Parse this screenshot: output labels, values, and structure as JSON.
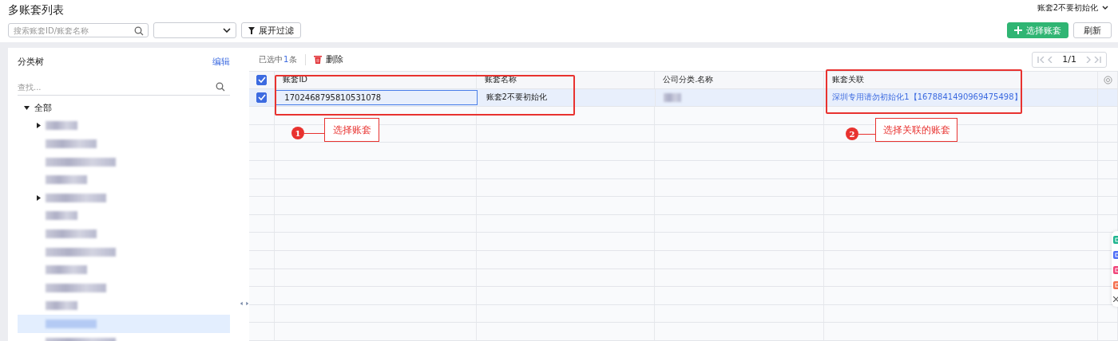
{
  "header": {
    "title": "多账套列表",
    "account_switcher": "账套2不要初始化",
    "search": {
      "placeholder": "搜索账套ID/账套名称"
    },
    "filter_button": "展开过滤",
    "buttons": [
      {
        "kind": "primary",
        "label": "选择账套"
      },
      {
        "kind": "default",
        "label": "刷新"
      }
    ]
  },
  "tree": {
    "title": "分类树",
    "edit_link": "编辑",
    "search": {
      "placeholder": "查找..."
    },
    "root": {
      "label": "全部",
      "expanded": true,
      "children": [
        {
          "kind": "redacted",
          "has_children": true,
          "selected": false
        },
        {
          "kind": "redacted",
          "has_children": false,
          "selected": false
        },
        {
          "kind": "redacted",
          "has_children": false,
          "selected": false
        },
        {
          "kind": "redacted",
          "has_children": false,
          "selected": false
        },
        {
          "kind": "redacted",
          "has_children": true,
          "selected": false
        },
        {
          "kind": "redacted",
          "has_children": false,
          "selected": false
        },
        {
          "kind": "redacted",
          "has_children": false,
          "selected": false
        },
        {
          "kind": "redacted",
          "has_children": false,
          "selected": false
        },
        {
          "kind": "redacted",
          "has_children": false,
          "selected": false
        },
        {
          "kind": "redacted",
          "has_children": false,
          "selected": false
        },
        {
          "kind": "redacted",
          "has_children": false,
          "selected": false
        },
        {
          "kind": "redacted",
          "has_children": false,
          "selected": true
        },
        {
          "kind": "redacted",
          "has_children": false,
          "selected": false
        }
      ]
    }
  },
  "toolbar": {
    "selection_prefix": "已选中",
    "selection_count": "1",
    "selection_suffix": "条",
    "delete_button": "删除"
  },
  "pager": {
    "label": "1/1",
    "prev_disabled": true,
    "next_disabled": true
  },
  "table": {
    "all_checked": true,
    "columns": [
      "账套ID",
      "账套名称",
      "公司分类.名称",
      "账套关联"
    ],
    "rows": [
      {
        "selected": true,
        "checked": true,
        "cells": [
          {
            "kind": "text",
            "text": "1702468795810531078",
            "editing": true
          },
          {
            "kind": "text",
            "text": "账套2不要初始化",
            "editing": false
          },
          {
            "kind": "redacted"
          },
          {
            "kind": "link",
            "text": "深圳专用请勿初始化1【1678841490969475498】",
            "editing": false
          }
        ]
      }
    ]
  },
  "annotations": [
    {
      "number": "1",
      "label": "选择账套"
    },
    {
      "number": "2",
      "label": "选择关联的账套"
    }
  ]
}
